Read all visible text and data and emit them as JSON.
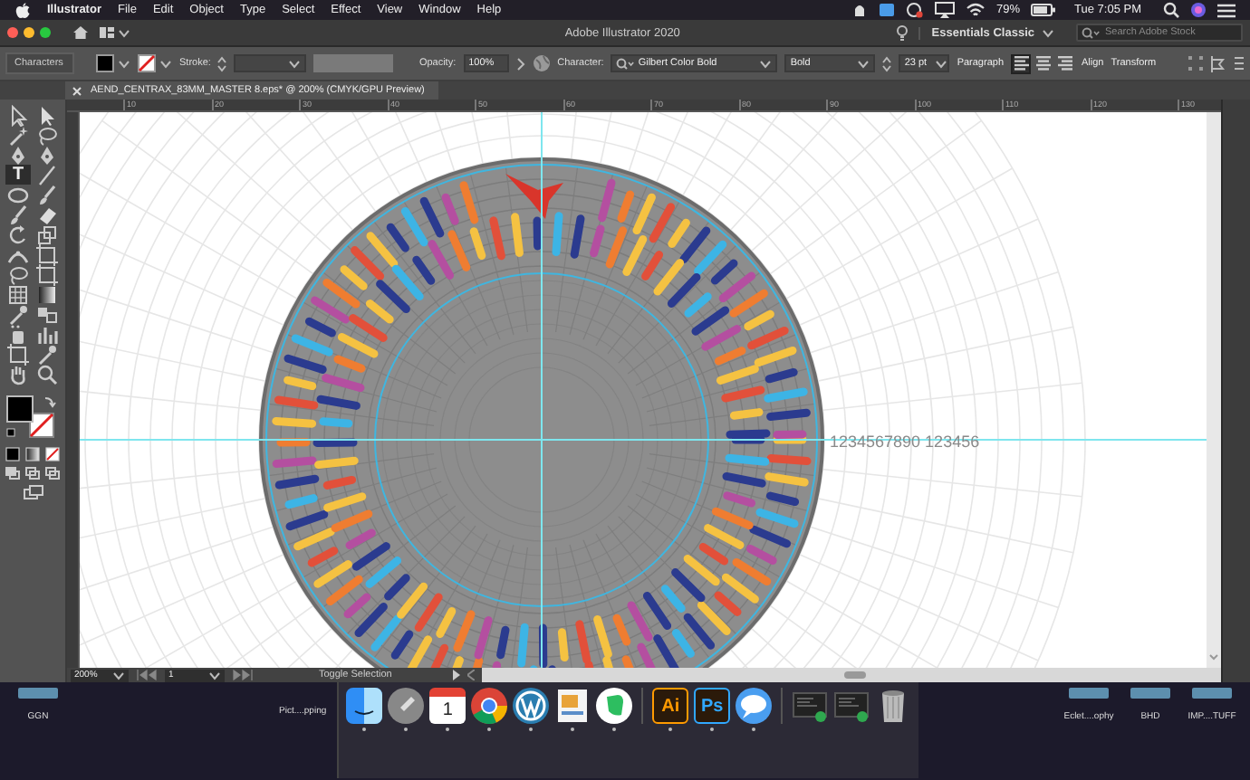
{
  "menu_bar": {
    "app": "Illustrator",
    "items": [
      "File",
      "Edit",
      "Object",
      "Type",
      "Select",
      "Effect",
      "View",
      "Window",
      "Help"
    ],
    "battery": "79%",
    "clock": "Tue 7:05 PM"
  },
  "title_bar": {
    "title": "Adobe Illustrator 2020",
    "workspace": "Essentials Classic",
    "search": {
      "placeholder": "Search Adobe Stock"
    }
  },
  "control_bar": {
    "panel_label": "Characters",
    "stroke_label": "Stroke:",
    "opacity_label": "Opacity:",
    "opacity": "100%",
    "character_label": "Character:",
    "font": "Gilbert Color Bold",
    "style": "Bold",
    "size": "23 pt",
    "paragraph": "Paragraph",
    "align_buttons": [
      {
        "kind": "left",
        "selected": true
      },
      {
        "kind": "center",
        "selected": false
      },
      {
        "kind": "right",
        "selected": false
      }
    ],
    "align": "Align",
    "transform": "Transform"
  },
  "document_tab": {
    "title": "AEND_CENTRAX_83MM_MASTER 8.eps* @ 200% (CMYK/GPU Preview)"
  },
  "ruler": [
    "10",
    "20",
    "30",
    "40",
    "50",
    "60",
    "70",
    "80",
    "90",
    "100",
    "110",
    "120",
    "130"
  ],
  "tools": [
    {
      "kind": "direct",
      "selected": false
    },
    {
      "kind": "select",
      "selected": false
    },
    {
      "kind": "wand",
      "selected": false
    },
    {
      "kind": "lasso",
      "selected": false
    },
    {
      "kind": "pen",
      "selected": false
    },
    {
      "kind": "pen",
      "selected": false
    },
    {
      "kind": "type",
      "label": "T",
      "selected": true
    },
    {
      "kind": "line",
      "selected": false
    },
    {
      "kind": "ellipse",
      "selected": false
    },
    {
      "kind": "brush",
      "selected": false
    },
    {
      "kind": "brush",
      "selected": false
    },
    {
      "kind": "eraser",
      "selected": false
    },
    {
      "kind": "rotate",
      "selected": false
    },
    {
      "kind": "scale",
      "selected": false
    },
    {
      "kind": "width",
      "selected": false
    },
    {
      "kind": "frame",
      "selected": false
    },
    {
      "kind": "lasso",
      "selected": false
    },
    {
      "kind": "frame",
      "selected": false
    },
    {
      "kind": "grid",
      "selected": false
    },
    {
      "kind": "gradient",
      "selected": false
    },
    {
      "kind": "dropper",
      "selected": false
    },
    {
      "kind": "blend",
      "selected": false
    },
    {
      "kind": "spray",
      "selected": false
    },
    {
      "kind": "graph",
      "selected": false
    },
    {
      "kind": "frame",
      "selected": false
    },
    {
      "kind": "dropper",
      "selected": false
    },
    {
      "kind": "hand",
      "selected": false
    },
    {
      "kind": "zoom",
      "selected": false
    }
  ],
  "canvas": {
    "sample_text": "1234567890 123456"
  },
  "status_bar": {
    "zoom": "200%",
    "page": "1",
    "action": "Toggle Selection"
  },
  "desktop": {
    "left_folder": "GGN",
    "window_label": "Pict....pping",
    "right_folders": [
      "Eclet....ophy",
      "BHD",
      "IMP....TUFF"
    ]
  },
  "dock": [
    {
      "kind": "finder",
      "running": true
    },
    {
      "kind": "launchpad",
      "running": true
    },
    {
      "kind": "calendar",
      "label": "1",
      "running": true
    },
    {
      "kind": "chrome",
      "running": true
    },
    {
      "kind": "wordpress",
      "running": true
    },
    {
      "kind": "preview",
      "running": true
    },
    {
      "kind": "evernote",
      "running": true
    },
    {
      "kind": "separator"
    },
    {
      "kind": "app",
      "label": "Ai",
      "color": "#ff9a00",
      "running": true
    },
    {
      "kind": "app",
      "label": "Ps",
      "color": "#31a8ff",
      "running": true
    },
    {
      "kind": "messages",
      "running": true
    },
    {
      "kind": "separator"
    },
    {
      "kind": "screenshot",
      "running": false
    },
    {
      "kind": "screenshot",
      "running": false
    },
    {
      "kind": "trash",
      "running": false
    }
  ]
}
